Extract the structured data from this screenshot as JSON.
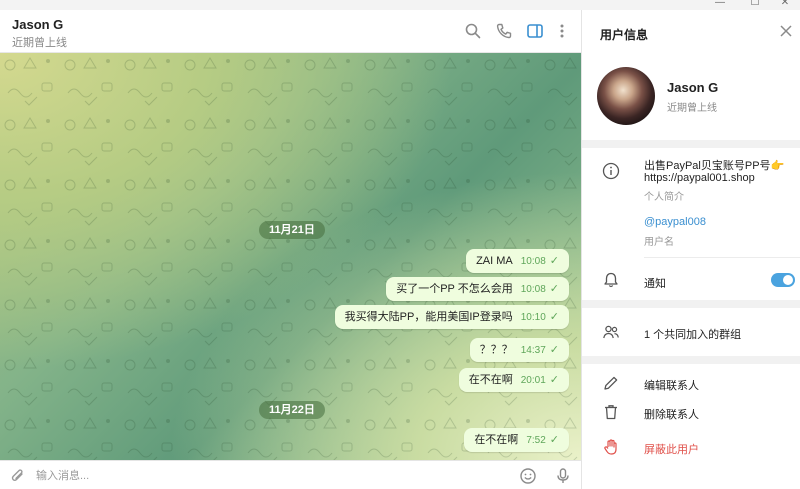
{
  "window": {
    "controls": [
      "—",
      "☐",
      "✕"
    ]
  },
  "chat": {
    "name": "Jason G",
    "status": "近期曾上线",
    "header_icons": [
      "search-icon",
      "phone-icon",
      "sidebar-toggle-icon",
      "more-vert-icon"
    ],
    "dates": [
      "11月21日",
      "11月22日"
    ],
    "messages": [
      {
        "text": "ZAI MA",
        "time": "10:08"
      },
      {
        "text": "买了一个PP  不怎么会用",
        "time": "10:08"
      },
      {
        "text": "我买得大陆PP，能用美国IP登录吗",
        "time": "10:10"
      },
      {
        "text": "？？？",
        "time": "14:37"
      },
      {
        "text": "在不在啊",
        "time": "20:01"
      },
      {
        "text": "在不在啊",
        "time": "7:52"
      }
    ],
    "composer_placeholder": "输入消息...",
    "composer_icons": [
      "attach-icon",
      "emoji-icon",
      "mic-icon"
    ]
  },
  "info": {
    "title": "用户信息",
    "name": "Jason G",
    "status": "近期曾上线",
    "bio": "出售PayPal贝宝账号PP号👉",
    "bio_link": "https://paypal001.shop",
    "bio_label": "个人简介",
    "username": "@paypal008",
    "username_label": "用户名",
    "notify_label": "通知",
    "notify_on": true,
    "groups": "1 个共同加入的群组",
    "edit": "编辑联系人",
    "delete": "删除联系人",
    "block": "屏蔽此用户",
    "accent_color": "#4aa3df",
    "danger_color": "#e0504a"
  }
}
